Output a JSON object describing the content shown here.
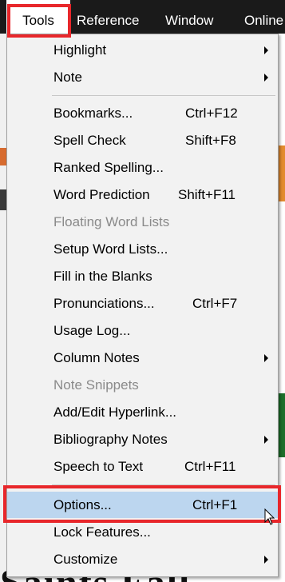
{
  "menubar": {
    "items": [
      "Tools",
      "Reference",
      "Window",
      "Online"
    ]
  },
  "background": {
    "bottom_text": "Saints Fall Ever"
  },
  "menu": {
    "items": [
      {
        "label": "Highlight",
        "submenu": true
      },
      {
        "label": "Note",
        "submenu": true
      },
      {
        "label": "Bookmarks...",
        "shortcut": "Ctrl+F12"
      },
      {
        "label": "Spell Check",
        "shortcut": "Shift+F8"
      },
      {
        "label": "Ranked Spelling..."
      },
      {
        "label": "Word Prediction",
        "shortcut": "Shift+F11"
      },
      {
        "label": "Floating Word Lists",
        "disabled": true
      },
      {
        "label": "Setup Word Lists..."
      },
      {
        "label": "Fill in the Blanks"
      },
      {
        "label": "Pronunciations...",
        "shortcut": "Ctrl+F7"
      },
      {
        "label": "Usage Log..."
      },
      {
        "label": "Column Notes",
        "submenu": true
      },
      {
        "label": "Note Snippets",
        "disabled": true
      },
      {
        "label": "Add/Edit Hyperlink..."
      },
      {
        "label": "Bibliography Notes",
        "submenu": true
      },
      {
        "label": "Speech to Text",
        "shortcut": "Ctrl+F11"
      },
      {
        "label": "Options...",
        "shortcut": "Ctrl+F1",
        "selected": true
      },
      {
        "label": "Lock Features..."
      },
      {
        "label": "Customize",
        "submenu": true
      }
    ]
  },
  "colors": {
    "menubar_bg": "#1a1a1a",
    "menu_bg": "#f2f2f2",
    "selected_bg": "#bcd6ef",
    "highlight_box": "#e8272b",
    "disabled_text": "#8a8a8a"
  }
}
